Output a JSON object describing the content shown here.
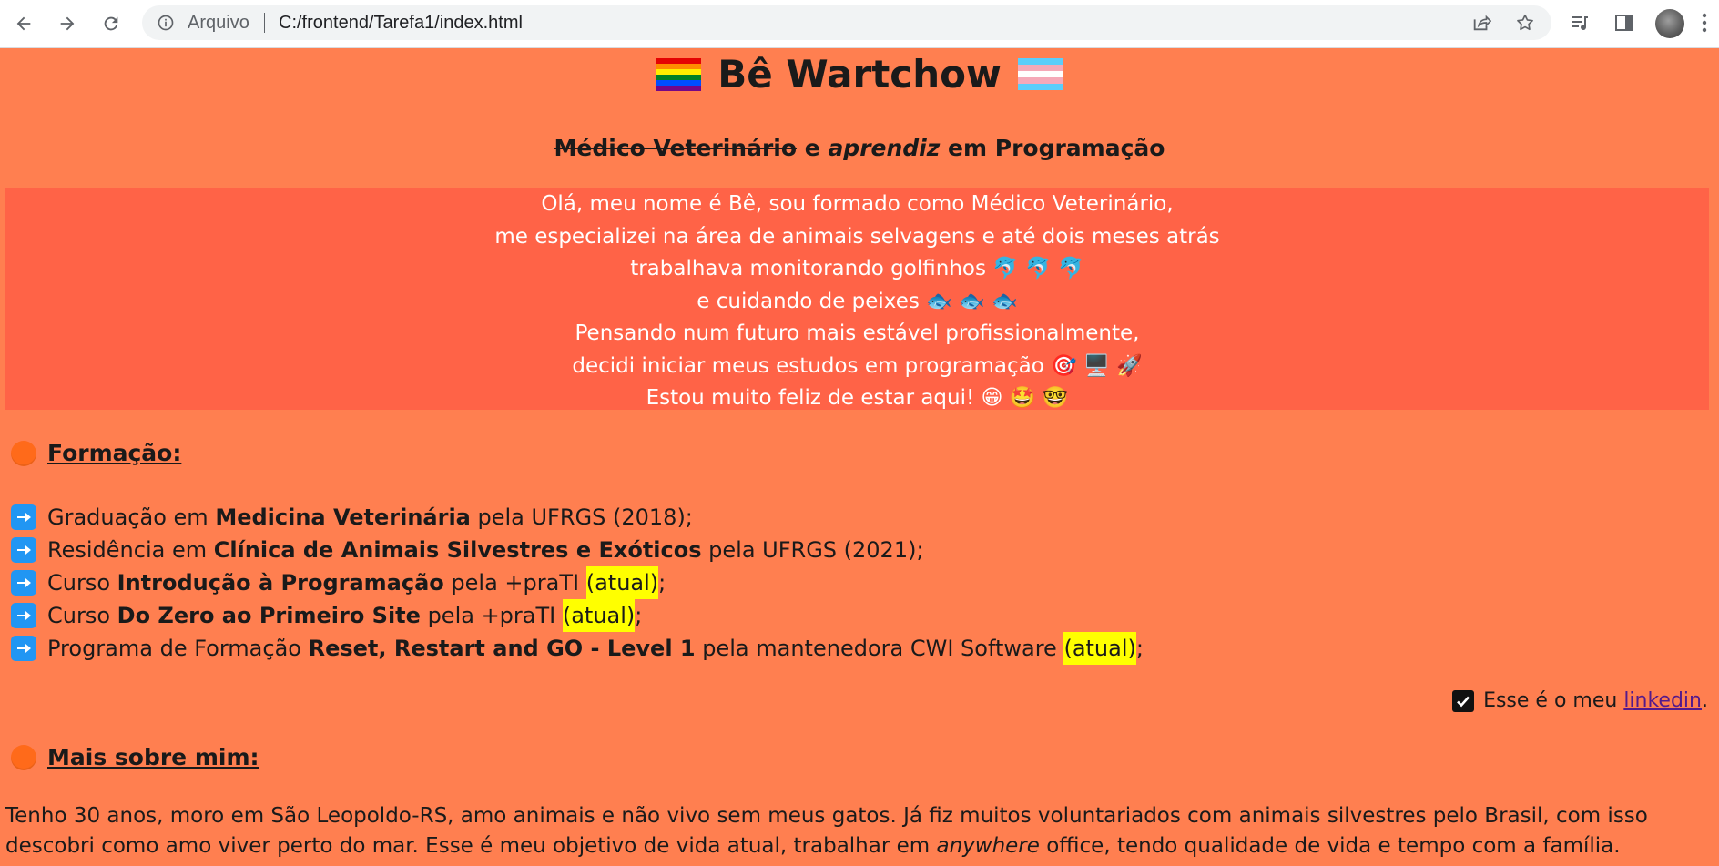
{
  "browser": {
    "omnibox_label": "Arquivo",
    "url": "C:/frontend/Tarefa1/index.html"
  },
  "page": {
    "title": "Bê Wartchow",
    "subtitle": {
      "struck": "Médico Veterinário",
      "connector": "e",
      "italic": "aprendiz",
      "rest": "em Programação"
    },
    "intro_lines": [
      "Olá, meu nome é Bê, sou formado como Médico Veterinário,",
      "me especializei na área de animais selvagens e até dois meses atrás",
      "trabalhava monitorando golfinhos 🐬 🐬 🐬",
      "e cuidando de peixes 🐟 🐟 🐟",
      "Pensando num futuro mais estável profissionalmente,",
      "decidi iniciar meus estudos em programação 🎯 🖥️ 🚀",
      "Estou muito feliz de estar aqui! 😁 🤩 🤓"
    ],
    "formacao": {
      "heading": "Formação:",
      "items": [
        {
          "pre": "Graduação em ",
          "bold": "Medicina Veterinária",
          "post": " pela UFRGS (2018);",
          "mark": "",
          "end": ""
        },
        {
          "pre": "Residência em ",
          "bold": "Clínica de Animais Silvestres e Exóticos",
          "post": " pela UFRGS (2021);",
          "mark": "",
          "end": ""
        },
        {
          "pre": "Curso ",
          "bold": "Introdução à Programação",
          "post": " pela +praTI ",
          "mark": "(atual)",
          "end": ";"
        },
        {
          "pre": "Curso ",
          "bold": "Do Zero ao Primeiro Site",
          "post": " pela +praTI ",
          "mark": "(atual)",
          "end": ";"
        },
        {
          "pre": "Programa de Formação ",
          "bold": "Reset, Restart and GO - Level 1",
          "post": " pela mantenedora CWI Software ",
          "mark": "(atual)",
          "end": ";"
        }
      ]
    },
    "linkedin": {
      "pre": "Esse é o meu ",
      "link": "linkedin",
      "post": "."
    },
    "mais_sobre": {
      "heading": "Mais sobre mim:",
      "text_a": "Tenho 30 anos, moro em São Leopoldo-RS, amo animais e não vivo sem meus gatos. Já fiz muitos voluntariados com animais silvestres pelo Brasil, com isso descobri como amo viver perto do mar. Esse é meu objetivo de vida atual, trabalhar em ",
      "italic": "anywhere",
      "text_b": " office, tendo qualidade de vida e tempo com a família."
    }
  },
  "colors": {
    "page_bg": "#ff7f50",
    "intro_bg": "#ff6347",
    "highlight": "#ffff00",
    "bullet": "#ff6a1a",
    "arrow_box": "#2196f3"
  },
  "icons": {
    "back": "arrow-left-icon",
    "forward": "arrow-right-icon",
    "reload": "reload-icon",
    "info": "info-icon",
    "share": "share-icon",
    "star": "star-icon",
    "media": "media-control-icon",
    "sidepanel": "side-panel-icon",
    "menu": "kebab-menu-icon",
    "rainbow_flag": "rainbow-flag-icon",
    "trans_flag": "transgender-flag-icon",
    "section_bullet": "orange-circle-icon",
    "list_bullet": "right-arrow-box-icon",
    "checkbox": "check-box-icon"
  }
}
